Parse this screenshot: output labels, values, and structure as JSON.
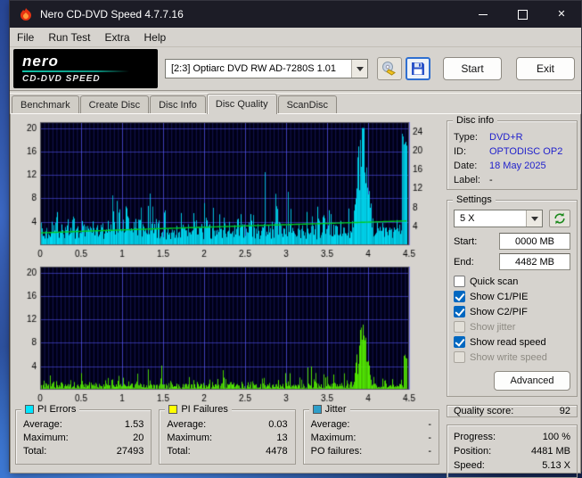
{
  "window": {
    "title": "Nero CD-DVD Speed 4.7.7.16"
  },
  "menu": {
    "items": [
      "File",
      "Run Test",
      "Extra",
      "Help"
    ]
  },
  "brand": {
    "name": "nero",
    "product": "CD-DVD SPEED"
  },
  "toolbar": {
    "drive_selector": "[2:3]    Optiarc DVD RW AD-7280S 1.01",
    "start_button": "Start",
    "exit_button": "Exit"
  },
  "tabs": [
    {
      "label": "Benchmark",
      "active": false
    },
    {
      "label": "Create Disc",
      "active": false
    },
    {
      "label": "Disc Info",
      "active": false
    },
    {
      "label": "Disc Quality",
      "active": true
    },
    {
      "label": "ScanDisc",
      "active": false
    }
  ],
  "disc_info": {
    "title": "Disc info",
    "rows": [
      {
        "label": "Type:",
        "value": "DVD+R",
        "value_color": "#2222cc"
      },
      {
        "label": "ID:",
        "value": "OPTODISC OP2",
        "value_color": "#2222cc"
      },
      {
        "label": "Date:",
        "value": "18 May 2025",
        "value_color": "#2222cc"
      },
      {
        "label": "Label:",
        "value": "-",
        "value_color": "#000000"
      }
    ]
  },
  "settings": {
    "title": "Settings",
    "speed_selector": "5 X",
    "start_label": "Start:",
    "start_value": "0000 MB",
    "end_label": "End:",
    "end_value": "4482 MB",
    "checkboxes": [
      {
        "label": "Quick scan",
        "state": "unchecked"
      },
      {
        "label": "Show C1/PIE",
        "state": "checked"
      },
      {
        "label": "Show C2/PIF",
        "state": "checked"
      },
      {
        "label": "Show jitter",
        "state": "disabled"
      },
      {
        "label": "Show read speed",
        "state": "checked"
      },
      {
        "label": "Show write speed",
        "state": "disabled"
      }
    ],
    "advanced_button": "Advanced"
  },
  "quality": {
    "label": "Quality score:",
    "value": "92"
  },
  "progress": {
    "rows": [
      {
        "label": "Progress:",
        "value": "100 %"
      },
      {
        "label": "Position:",
        "value": "4481 MB"
      },
      {
        "label": "Speed:",
        "value": "5.13 X"
      }
    ]
  },
  "stats_boxes": [
    {
      "title": "PI Errors",
      "swatch": "#00e5ff",
      "rows": [
        {
          "label": "Average:",
          "value": "1.53"
        },
        {
          "label": "Maximum:",
          "value": "20"
        },
        {
          "label": "Total:",
          "value": "27493"
        }
      ]
    },
    {
      "title": "PI Failures",
      "swatch": "#ffff00",
      "rows": [
        {
          "label": "Average:",
          "value": "0.03"
        },
        {
          "label": "Maximum:",
          "value": "13"
        },
        {
          "label": "Total:",
          "value": "4478"
        }
      ]
    },
    {
      "title": "Jitter",
      "swatch": "#2e9ec9",
      "rows": [
        {
          "label": "Average:",
          "value": "-"
        },
        {
          "label": "Maximum:",
          "value": "-"
        },
        {
          "label": "PO failures:",
          "value": "-"
        }
      ]
    }
  ],
  "icons": {
    "app": "nero-flame",
    "burn": "burn-disc",
    "save": "save-disk",
    "refresh": "refresh-arrows",
    "combo_arrow": "chevron-down"
  },
  "colors": {
    "accent": "#0067c0",
    "titlebar": "#1c1c26",
    "window_bg": "#d6d3ce"
  },
  "chart_data": [
    {
      "name": "PI Errors vs disc position (GB)",
      "type": "area",
      "color": "#00e0f8",
      "x_range": [
        0,
        4.5
      ],
      "x_data_end": 4.47,
      "x_tick_labels": [
        "0",
        "0.5",
        "1",
        "1.5",
        "2",
        "2.5",
        "3",
        "3.5",
        "4",
        "4.5"
      ],
      "y_ticks": [
        4,
        8,
        12,
        16,
        20
      ],
      "y_max_plot": 21,
      "right_ticks": [
        4,
        8,
        12,
        16,
        20,
        24
      ],
      "right_max_plot": 26,
      "noise": {
        "seed": 7,
        "base": 1.0,
        "base_amp": 2.0,
        "dense_p": 0.7,
        "dense_amp": 4.8,
        "spike_p": 0.05,
        "spike_amp": 9,
        "clamp": 20
      },
      "cluster": {
        "x0": 3.8,
        "x1": 4.05,
        "peak": 20
      },
      "end_block": {
        "x0": 4.41,
        "x1": 4.47,
        "peak": 20
      },
      "speed_line": {
        "color": "#00cc22",
        "start": 2.6,
        "end": 5.13
      }
    },
    {
      "name": "PI Failures vs disc position (GB)",
      "type": "area",
      "color": "#55f000",
      "x_range": [
        0,
        4.5
      ],
      "x_data_end": 4.47,
      "x_tick_labels": [
        "0",
        "0.5",
        "1",
        "1.5",
        "2",
        "2.5",
        "3",
        "3.5",
        "4",
        "4.5"
      ],
      "y_ticks": [
        4,
        8,
        12,
        16,
        20
      ],
      "y_max_plot": 21,
      "noise": {
        "seed": 12,
        "base": 0.15,
        "base_amp": 0.9,
        "dense_p": 0.45,
        "dense_amp": 1.8,
        "spike_p": 0.05,
        "spike_amp": 3.2,
        "clamp": 20
      },
      "cluster": {
        "x0": 3.82,
        "x1": 4.04,
        "peak": 12.5
      },
      "end_block": {
        "x0": 4.43,
        "x1": 4.47,
        "peak": 6
      }
    }
  ]
}
